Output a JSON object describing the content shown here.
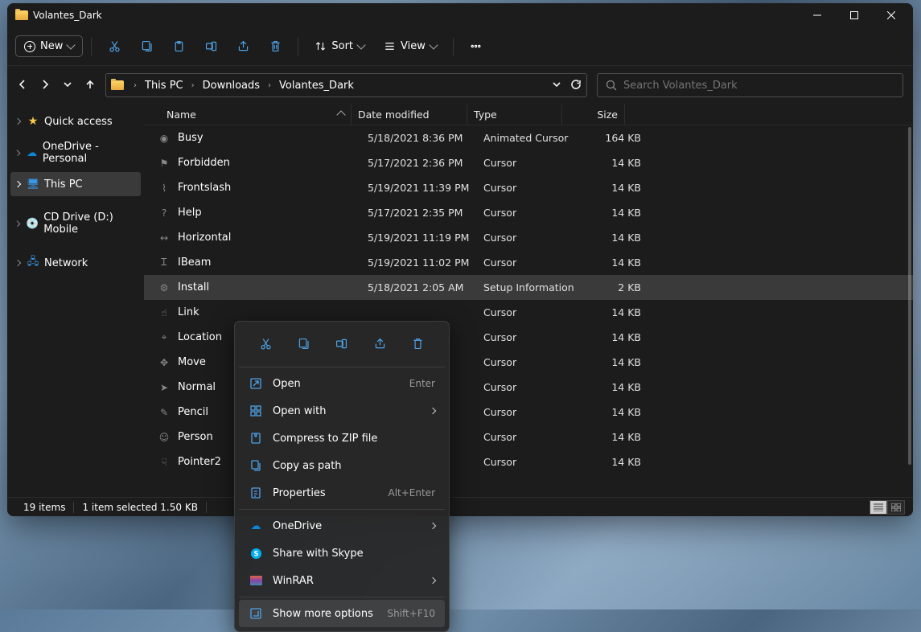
{
  "window": {
    "title": "Volantes_Dark"
  },
  "toolbar": {
    "new_label": "New",
    "sort_label": "Sort",
    "view_label": "View"
  },
  "breadcrumb": [
    "This PC",
    "Downloads",
    "Volantes_Dark"
  ],
  "search": {
    "placeholder": "Search Volantes_Dark"
  },
  "sidebar": {
    "items": [
      {
        "label": "Quick access",
        "icon": "star"
      },
      {
        "label": "OneDrive - Personal",
        "icon": "cloud"
      },
      {
        "label": "This PC",
        "icon": "pc",
        "active": true
      },
      {
        "label": "CD Drive (D:) Mobile",
        "icon": "disc"
      },
      {
        "label": "Network",
        "icon": "net"
      }
    ]
  },
  "columns": {
    "name": "Name",
    "date": "Date modified",
    "type": "Type",
    "size": "Size"
  },
  "files": [
    {
      "name": "Busy",
      "date": "5/18/2021 8:36 PM",
      "type": "Animated Cursor",
      "size": "164 KB",
      "icon": "◉"
    },
    {
      "name": "Forbidden",
      "date": "5/17/2021 2:36 PM",
      "type": "Cursor",
      "size": "14 KB",
      "icon": "⚑"
    },
    {
      "name": "Frontslash",
      "date": "5/19/2021 11:39 PM",
      "type": "Cursor",
      "size": "14 KB",
      "icon": "⌇"
    },
    {
      "name": "Help",
      "date": "5/17/2021 2:35 PM",
      "type": "Cursor",
      "size": "14 KB",
      "icon": "?"
    },
    {
      "name": "Horizontal",
      "date": "5/19/2021 11:19 PM",
      "type": "Cursor",
      "size": "14 KB",
      "icon": "↔"
    },
    {
      "name": "IBeam",
      "date": "5/19/2021 11:02 PM",
      "type": "Cursor",
      "size": "14 KB",
      "icon": "Ꮖ"
    },
    {
      "name": "Install",
      "date": "5/18/2021 2:05 AM",
      "type": "Setup Information",
      "size": "2 KB",
      "icon": "⚙",
      "selected": true
    },
    {
      "name": "Link",
      "date": "",
      "type": "Cursor",
      "size": "14 KB",
      "icon": "☝"
    },
    {
      "name": "Location",
      "date": "",
      "type": "Cursor",
      "size": "14 KB",
      "icon": "⌖"
    },
    {
      "name": "Move",
      "date": "",
      "type": "Cursor",
      "size": "14 KB",
      "icon": "✥"
    },
    {
      "name": "Normal",
      "date": "",
      "type": "Cursor",
      "size": "14 KB",
      "icon": "➤"
    },
    {
      "name": "Pencil",
      "date": "",
      "type": "Cursor",
      "size": "14 KB",
      "icon": "✎"
    },
    {
      "name": "Person",
      "date": "",
      "type": "Cursor",
      "size": "14 KB",
      "icon": "☺"
    },
    {
      "name": "Pointer2",
      "date": "",
      "type": "Cursor",
      "size": "14 KB",
      "icon": "☟"
    }
  ],
  "status": {
    "items": "19 items",
    "selected": "1 item selected  1.50 KB"
  },
  "context_menu": {
    "open": "Open",
    "open_shortcut": "Enter",
    "open_with": "Open with",
    "compress": "Compress to ZIP file",
    "copy_path": "Copy as path",
    "properties": "Properties",
    "properties_shortcut": "Alt+Enter",
    "onedrive": "OneDrive",
    "skype": "Share with Skype",
    "winrar": "WinRAR",
    "more_options": "Show more options",
    "more_options_shortcut": "Shift+F10"
  }
}
